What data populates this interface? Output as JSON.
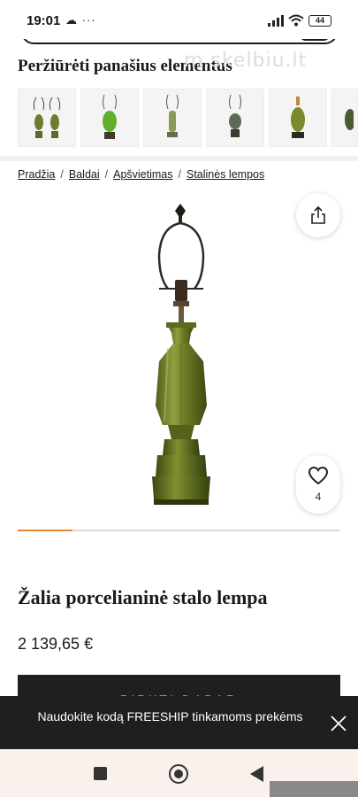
{
  "status_bar": {
    "time": "19:01",
    "left_icons": "☁ ···",
    "battery": "44"
  },
  "watermark": "m.skelbiu.lt",
  "similar": {
    "title": "Peržiūrėti panašius elementus",
    "thumbnails": [
      {
        "name": "twin-green-lamps-thumbnail"
      },
      {
        "name": "bright-green-lamp-thumbnail"
      },
      {
        "name": "slim-olive-lamp-thumbnail"
      },
      {
        "name": "ornate-lamp-thumbnail"
      },
      {
        "name": "olive-vase-lamp-thumbnail"
      },
      {
        "name": "partial-lamp-thumbnail"
      }
    ]
  },
  "breadcrumb": {
    "items": [
      "Pradžia",
      "Baldai",
      "Apšvietimas",
      "Stalinės lempos"
    ],
    "separator": "/"
  },
  "gallery": {
    "favorite_count": "4",
    "image": "green-porcelain-table-lamp",
    "carousel_progress": 0.17
  },
  "product": {
    "title": "Žalia porcelianinė stalo lempa",
    "price": "2 139,65 €",
    "buy_label": "PIRKTI DABAR"
  },
  "promo": {
    "text": "Naudokite kodą FREESHIP tinkamoms prekėms"
  },
  "colors": {
    "accent": "#e8862a",
    "dark": "#1f1f1f",
    "lamp_green": "#7a8a2e"
  }
}
